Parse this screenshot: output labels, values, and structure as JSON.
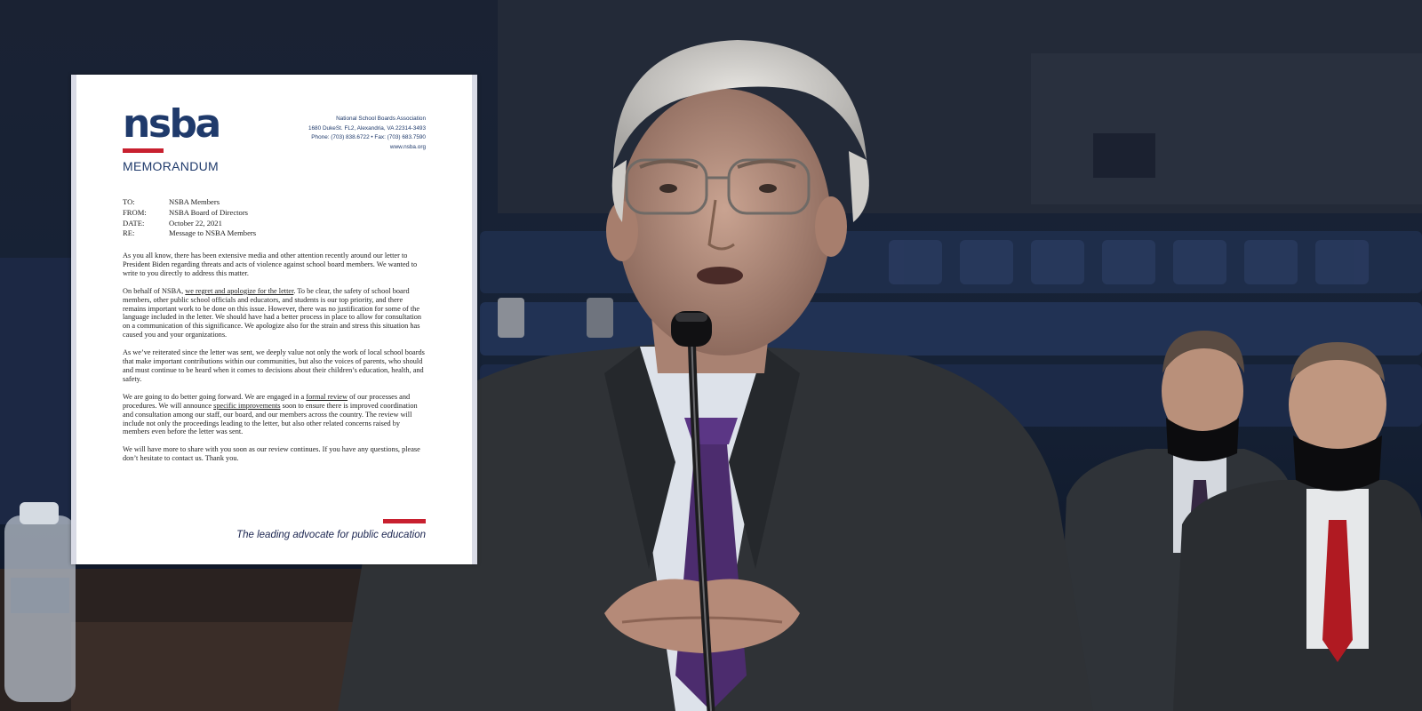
{
  "memo": {
    "logo_text": "nsba",
    "heading": "MEMORANDUM",
    "org": {
      "name": "National School Boards Association",
      "address": "1680 DukeSt. FL2, Alexandria, VA 22314-3493",
      "phone_fax": "Phone: (703) 838.6722 • Fax: (703) 683.7590",
      "website": "www.nsba.org"
    },
    "header_fields": [
      {
        "label": "TO:",
        "value": "NSBA Members"
      },
      {
        "label": "FROM:",
        "value": "NSBA Board of Directors"
      },
      {
        "label": "DATE:",
        "value": "October 22, 2021"
      },
      {
        "label": "RE:",
        "value": "Message to NSBA Members"
      }
    ],
    "paragraphs": {
      "p1": "As you all know, there has been extensive media and other attention recently around our letter to President Biden regarding threats and acts of violence against school board members. We wanted to write to you directly to address this matter.",
      "p2_pre": "On behalf of NSBA, ",
      "p2_link": "we regret and apologize for the letter",
      "p2_post": ". To be clear, the safety of school board members, other public school officials and educators, and students is our top priority, and there remains important work to be done on this issue. However, there was no justification for some of the language included in the letter. We should have had a better process in place to allow for consultation on a communication of this significance. We apologize also for the strain and stress this situation has caused you and your organizations.",
      "p3": "As we’ve reiterated since the letter was sent, we deeply value not only the work of local school boards that make important contributions within our communities, but also the voices of parents, who should and must continue to be heard when it comes to decisions about their children’s education, health, and safety.",
      "p4_pre": "We are going to do better going forward. We are engaged in a ",
      "p4_link1": "formal review",
      "p4_mid": " of our processes and procedures. We will announce ",
      "p4_link2": "specific improvements",
      "p4_post": " soon to ensure there is improved coordination and consultation among our staff, our board, and our members across the country. The review will include not only the proceedings leading to the letter, but also other related concerns raised by members even before the letter was sent.",
      "p5": "We will have more to share with you soon as our review continues. If you have any questions, please don’t hesitate to contact us. Thank you."
    },
    "tagline": "The leading advocate for public education",
    "colors": {
      "navy": "#1f3a6b",
      "red": "#c8202f"
    }
  }
}
